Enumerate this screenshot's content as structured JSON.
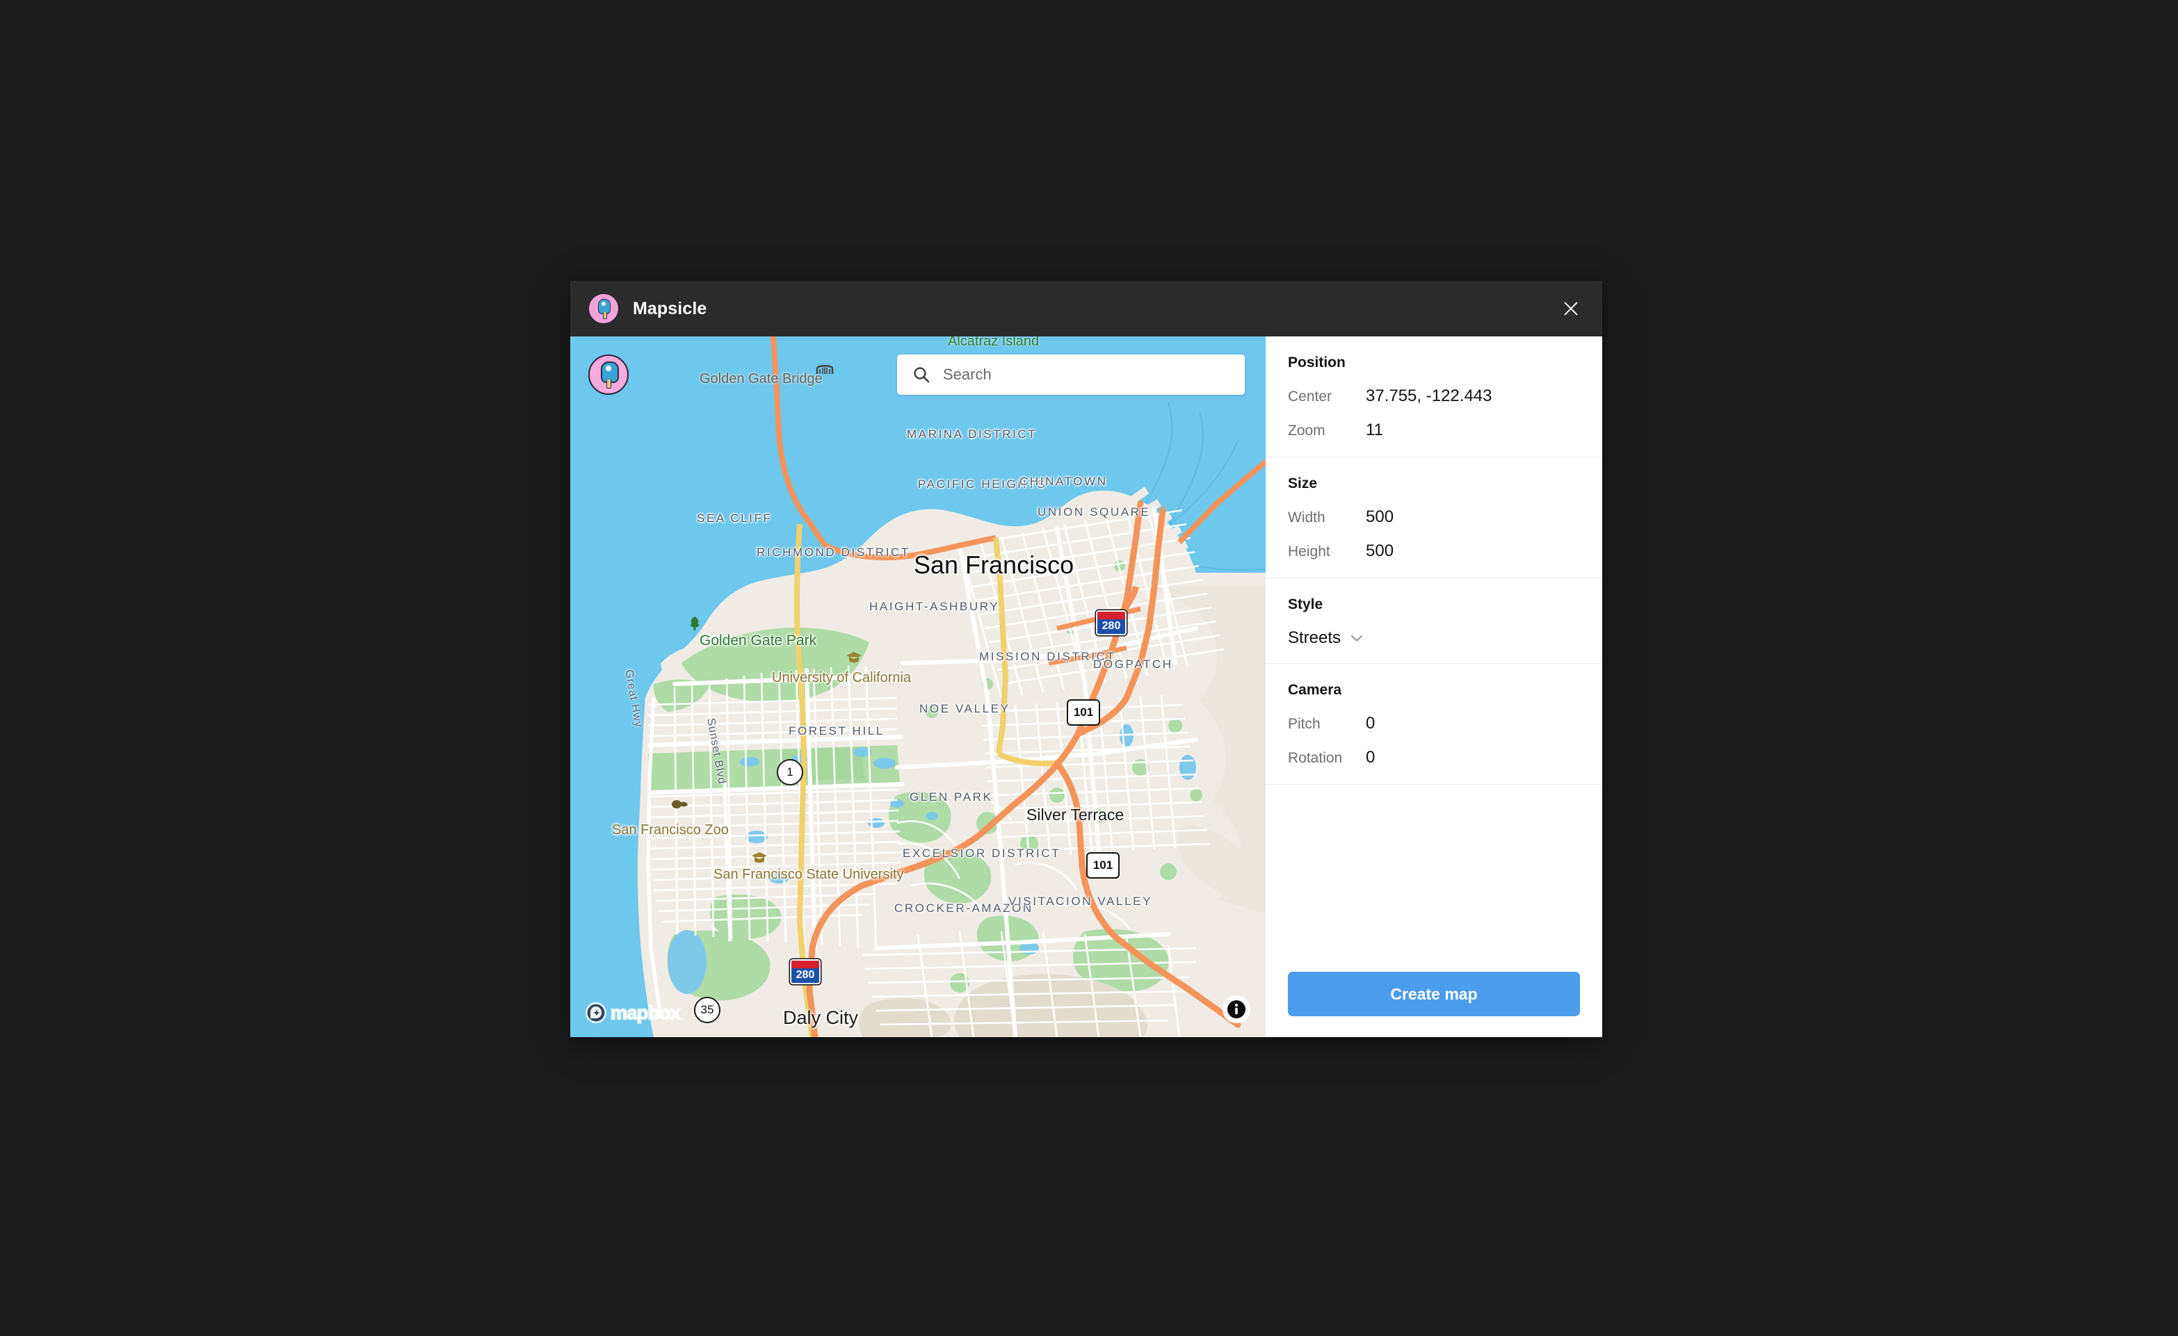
{
  "window": {
    "title": "Mapsicle",
    "logo_icon": "popsicle-icon",
    "close_icon": "close-icon"
  },
  "map": {
    "badge_icon": "popsicle-marker-icon",
    "search": {
      "placeholder": "Search",
      "value": "",
      "icon": "search-icon"
    },
    "attribution": "mapbox",
    "attribution_icon": "mapbox-logo-icon",
    "info_icon": "info-icon",
    "labels": {
      "city": "San Francisco",
      "districts": [
        "MARINA DISTRICT",
        "PACIFIC HEIGHTS",
        "CHINATOWN",
        "UNION SQUARE",
        "SEA CLIFF",
        "RICHMOND DISTRICT",
        "HAIGHT-ASHBURY",
        "MISSION DISTRICT",
        "DOGPATCH",
        "NOE VALLEY",
        "FOREST HILL",
        "GLEN PARK",
        "EXCELSIOR DISTRICT",
        "CROCKER-AMAZON",
        "VISITACION VALLEY"
      ],
      "places": [
        "Silver Terrace",
        "Daly City"
      ],
      "parks": [
        "Golden Gate Park"
      ],
      "pois": [
        "University of California",
        "San Francisco State University",
        "San Francisco Zoo"
      ],
      "water_features": [
        "Alcatraz Island"
      ],
      "bridges": [
        "Golden Gate Bridge"
      ],
      "roads": [
        "Great Hwy",
        "Sunset Blvd"
      ],
      "shields": [
        "1",
        "35",
        "101",
        "101",
        "280",
        "280"
      ]
    },
    "colors": {
      "water": "#6ec7ec",
      "land": "#f0ece5",
      "park": "#a8d9a0",
      "motorway": "#f4945a",
      "primary": "#f2d06b"
    }
  },
  "panel": {
    "sections": [
      {
        "title": "Position",
        "fields": [
          {
            "label": "Center",
            "value": "37.755, -122.443"
          },
          {
            "label": "Zoom",
            "value": "11"
          }
        ]
      },
      {
        "title": "Size",
        "fields": [
          {
            "label": "Width",
            "value": "500"
          },
          {
            "label": "Height",
            "value": "500"
          }
        ]
      },
      {
        "title": "Style",
        "select": {
          "value": "Streets",
          "icon": "chevron-down-icon"
        }
      },
      {
        "title": "Camera",
        "fields": [
          {
            "label": "Pitch",
            "value": "0"
          },
          {
            "label": "Rotation",
            "value": "0"
          }
        ]
      }
    ],
    "create_button": {
      "label": "Create map",
      "color": "#4a9ded"
    }
  }
}
